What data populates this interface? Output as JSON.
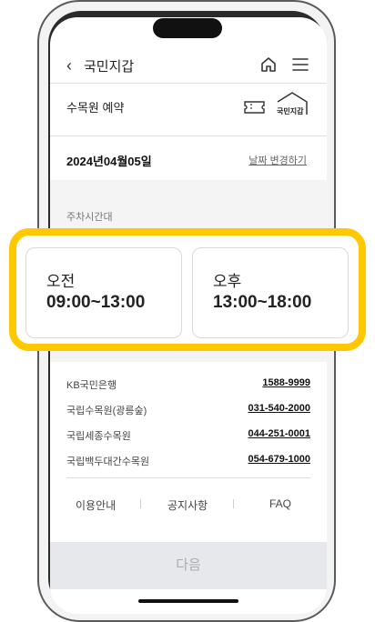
{
  "header": {
    "back_icon": "chevron-left-icon",
    "title": "국민지갑"
  },
  "page": {
    "section_title": "수목원 예약",
    "kb_logo_text": "국민지갑"
  },
  "date": {
    "value": "2024년04월05일",
    "change_label": "날짜 변경하기"
  },
  "parking": {
    "label": "주차시간대"
  },
  "slots": [
    {
      "label": "오전",
      "time": "09:00~13:00"
    },
    {
      "label": "오후",
      "time": "13:00~18:00"
    }
  ],
  "contacts": [
    {
      "name": "KB국민은행",
      "phone": "1588-9999"
    },
    {
      "name": "국립수목원(광릉숲)",
      "phone": "031-540-2000"
    },
    {
      "name": "국립세종수목원",
      "phone": "044-251-0001"
    },
    {
      "name": "국립백두대간수목원",
      "phone": "054-679-1000"
    }
  ],
  "footer": {
    "links": [
      "이용안내",
      "공지사항",
      "FAQ"
    ]
  },
  "next_button": {
    "label": "다음"
  },
  "colors": {
    "highlight": "#ffc800",
    "disabled_button_bg": "#e6e8eb"
  }
}
